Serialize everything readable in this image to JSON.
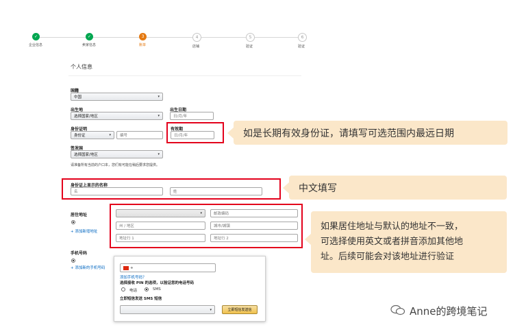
{
  "steps": [
    {
      "label": "企业信息",
      "state": "done",
      "num": "✓"
    },
    {
      "label": "卖家信息",
      "state": "done",
      "num": "✓"
    },
    {
      "label": "账单",
      "state": "current",
      "num": "3"
    },
    {
      "label": "店铺",
      "state": "todo",
      "num": "4"
    },
    {
      "label": "验证",
      "state": "todo",
      "num": "5"
    },
    {
      "label": "验证",
      "state": "todo",
      "num": "6"
    }
  ],
  "section_title": "个人信息",
  "nationality": {
    "label": "国籍",
    "value": "中国"
  },
  "birthplace": {
    "label": "出生地",
    "value": "选择国家/地区"
  },
  "birthdate": {
    "label": "出生日期",
    "placeholder": "日/月/年"
  },
  "id_proof": {
    "label": "身份证明",
    "type_value": "身份证",
    "number_placeholder": "编号"
  },
  "expiry": {
    "label": "有效期",
    "placeholder": "日/月/年"
  },
  "issuing_country": {
    "label": "签发国",
    "value": "选择国家/地区"
  },
  "note_text": "请准备所有当前的户口本，您们有可能在稍后要求您提供。",
  "name_on_id": {
    "label": "身份证上显示的名称",
    "first_placeholder": "名",
    "last_placeholder": "姓"
  },
  "address": {
    "label": "居住地址",
    "country_select": "",
    "postal_placeholder": "邮政编码",
    "state_placeholder": "州 / 地区",
    "city_placeholder": "城市/城镇",
    "line1_placeholder": "地址行 1",
    "line2_placeholder": "地址行 2",
    "add_link": "+ 添加新增地址"
  },
  "phone": {
    "label": "手机号码",
    "add_link": "+ 添加新的手机号码",
    "country_code": "+",
    "invalid_link": "添加手机号码？",
    "pin_heading": "选择接收 PIN 的选项，以验证您的电话号码",
    "option_call": "电话",
    "option_sms": "SMS",
    "language_label": "立即短信发送 SMS 短信",
    "language_value": "",
    "send_button": "立即短信发送信"
  },
  "callouts": {
    "expiry": "如是长期有效身份证，请填写可选范围内最远日期",
    "name": "中文填写",
    "address_line1": "如果居住地址与默认的地址不一致，",
    "address_line2": "可选择使用英文或者拼音添加其他地",
    "address_line3": "址。后续可能会对该地址进行验证"
  },
  "watermark": "Anne的跨境笔记",
  "colors": {
    "done": "#00a650",
    "current": "#e47911",
    "highlight": "#e3001b",
    "callout_bg": "#fbe7c9"
  }
}
